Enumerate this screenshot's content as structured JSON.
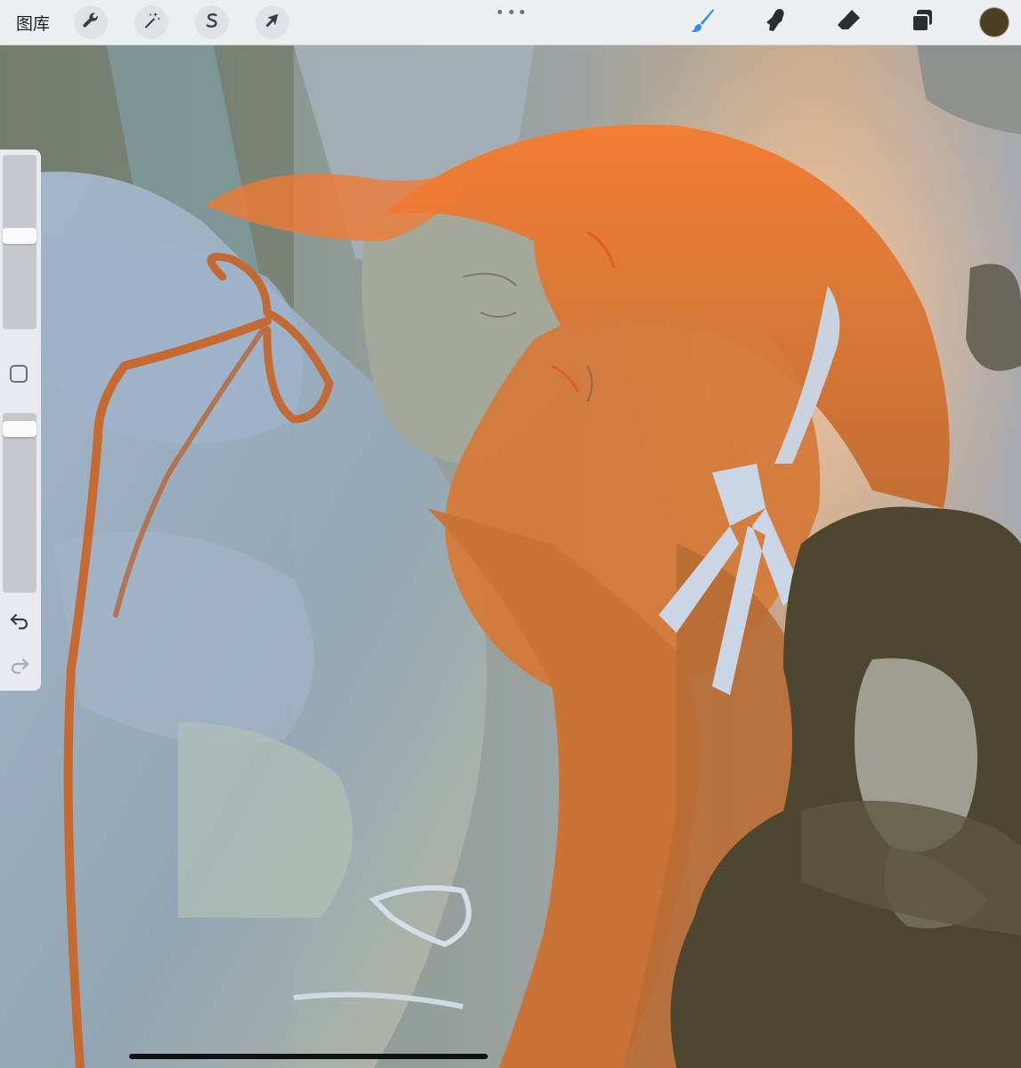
{
  "topbar": {
    "gallery_label": "图库",
    "left_tools": [
      {
        "name": "actions",
        "icon": "wrench-icon"
      },
      {
        "name": "adjustments",
        "icon": "magic-wand-icon"
      },
      {
        "name": "selection",
        "icon": "selection-s-icon"
      },
      {
        "name": "transform",
        "icon": "arrow-cursor-icon"
      }
    ],
    "more_icon": "more-dots-icon",
    "right_tools": [
      {
        "name": "brush",
        "icon": "brush-icon",
        "active": true
      },
      {
        "name": "smudge",
        "icon": "smudge-finger-icon",
        "active": false
      },
      {
        "name": "eraser",
        "icon": "eraser-icon",
        "active": false
      },
      {
        "name": "layers",
        "icon": "layers-icon",
        "active": false
      }
    ],
    "current_color": "#4e3f22",
    "active_tool_color": "#2f8cf0"
  },
  "sidebar": {
    "brush_size": 0.54,
    "brush_opacity": 0.95,
    "modify_icon": "square-modify-icon",
    "undo_icon": "undo-icon",
    "redo_icon": "redo-icon"
  },
  "palette": {
    "hair_orange": "#f07a32",
    "hair_dark": "#b7642c",
    "dress_blue": "#98aec8",
    "skin_grey": "#a3a89b",
    "background_grey": "#8a8d86",
    "dark_olive": "#4d4630"
  }
}
